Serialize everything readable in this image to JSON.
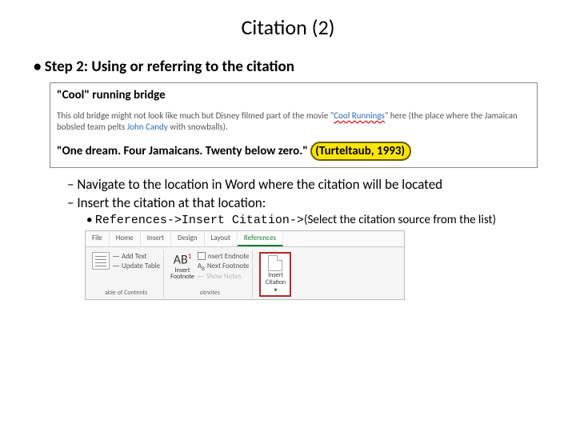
{
  "title": "Citation (2)",
  "step": "Step 2: Using or referring to the citation",
  "doc": {
    "heading_prefix": "\"Cool\"",
    "heading_rest": " running bridge",
    "body_pre": "This old bridge might not look like much but Disney filmed part of the movie \"",
    "movie": "Cool Runnings",
    "body_mid": "\" here (the place where the Jamaican bobsled team pelts ",
    "actor": "John Candy",
    "body_post": " with snowballs).",
    "quote_pre": "\"One dream. Four Jamaicans. Twenty below zero.\" ",
    "cite": "(Turteltaub, 1993)"
  },
  "nav1": "Navigate to the location in Word where the citation will be located",
  "nav2": "Insert the citation at that location:",
  "path": {
    "code": "References->Insert Citation->",
    "tail": "(Select the citation source from the list)"
  },
  "ribbon": {
    "tabs": [
      "File",
      "Home",
      "Insert",
      "Design",
      "Layout",
      "References"
    ],
    "active": 5,
    "toc": {
      "add": "Add Text",
      "update": "Update Table",
      "label": "able of Contents"
    },
    "fn": {
      "button": "Insert\nFootnote",
      "endnote": "nsert Endnote",
      "next": "Next Footnote",
      "show": "Show Notes",
      "label": "otnotes"
    },
    "cit": {
      "line1": "Insert",
      "line2": "Citation"
    }
  }
}
